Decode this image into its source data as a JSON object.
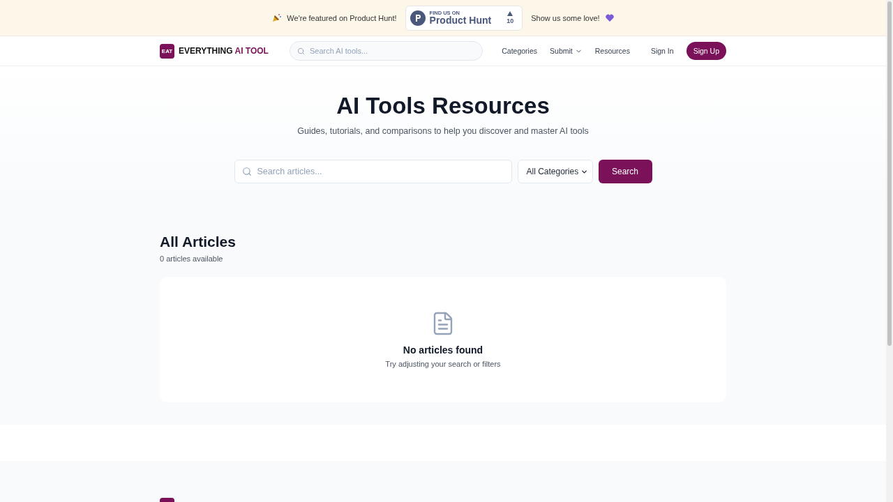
{
  "banner": {
    "featured_text": "We're featured on Product Hunt!",
    "badge": {
      "caption": "FIND US ON",
      "name": "Product Hunt",
      "votes": "10"
    },
    "love_text": "Show us some love!"
  },
  "nav": {
    "logo_mark": "EAT",
    "logo_text": "EVERYTHING",
    "logo_accent": "AI TOOL",
    "search": {
      "placeholder": "Search AI tools..."
    },
    "links": [
      {
        "label": "Categories",
        "dropdown": false
      },
      {
        "label": "Submit",
        "dropdown": true
      },
      {
        "label": "Resources",
        "dropdown": false
      }
    ],
    "sign_in": "Sign In",
    "sign_up": "Sign Up"
  },
  "hero": {
    "title": "AI Tools Resources",
    "subtitle": "Guides, tutorials, and comparisons to help you discover and master AI tools",
    "search": {
      "placeholder": "Search articles..."
    },
    "category": "All Categories",
    "search_button": "Search"
  },
  "articles": {
    "title": "All Articles",
    "count": "0 articles available",
    "empty_title": "No articles found",
    "empty_hint": "Try adjusting your search or filters"
  }
}
